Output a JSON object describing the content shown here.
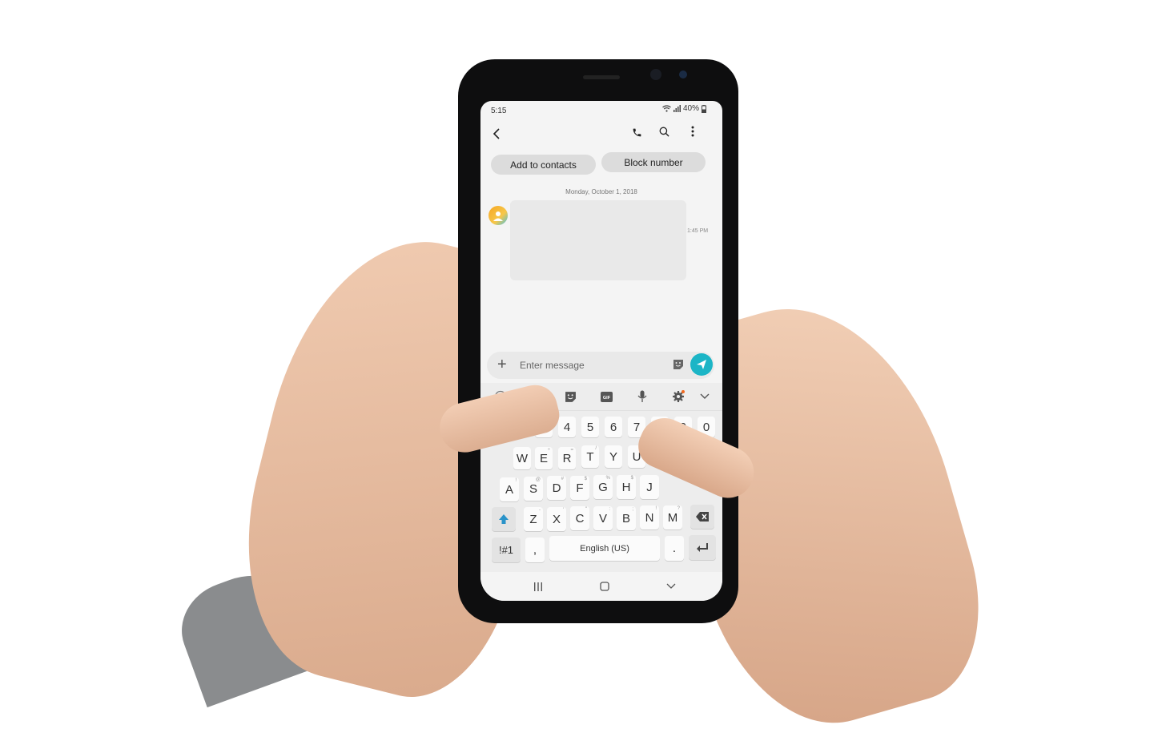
{
  "status_bar": {
    "time": "5:15",
    "battery": "40%"
  },
  "actions": {
    "add_to_contacts": "Add to contacts",
    "block_number": "Block number"
  },
  "conversation": {
    "date_separator": "Monday, October 1, 2018",
    "message_time": "1:45 PM"
  },
  "composer": {
    "placeholder": "Enter message"
  },
  "keyboard": {
    "number_row": [
      "3",
      "4",
      "5",
      "6",
      "7",
      "8",
      "9",
      "0"
    ],
    "row1": [
      "W",
      "E",
      "R",
      "T",
      "Y",
      "U"
    ],
    "row1_subs": [
      "",
      "÷",
      "=",
      "/",
      "",
      ""
    ],
    "row2": [
      "A",
      "S",
      "D",
      "F",
      "G",
      "H",
      "J"
    ],
    "row2_subs": [
      "!",
      "@",
      "#",
      "$",
      "%",
      "$",
      ""
    ],
    "row3": [
      "Z",
      "X",
      "C",
      "V",
      "B",
      "N",
      "M"
    ],
    "row3_subs": [
      "-",
      "'",
      "\"",
      ":",
      ";",
      "!",
      "?"
    ],
    "symbols_key": "!#1",
    "comma_key": ",",
    "space_label": "English (US)",
    "period_key": "."
  },
  "colors": {
    "accent": "#1cb5c6",
    "settings_dot": "#f26b21"
  }
}
